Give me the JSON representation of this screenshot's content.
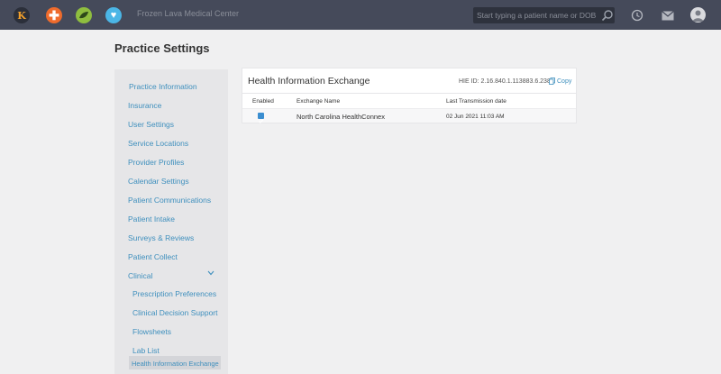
{
  "topbar": {
    "apps": [
      {
        "icon": "kareo-k-icon",
        "glyph": "K"
      },
      {
        "icon": "medical-plus-icon",
        "glyph": "✚"
      },
      {
        "icon": "leaf-icon",
        "glyph": ""
      },
      {
        "icon": "heart-icon",
        "glyph": "♥"
      }
    ],
    "center_name": "Frozen Lava Medical Center",
    "search": {
      "placeholder": "Start typing a patient name or DOB",
      "value": ""
    },
    "icons": [
      "search-icon",
      "history-icon",
      "mail-icon",
      "avatar"
    ]
  },
  "page": {
    "title": "Practice Settings"
  },
  "sidebar": {
    "items": [
      {
        "label": "Practice Information"
      },
      {
        "label": "Insurance"
      },
      {
        "label": "User Settings"
      },
      {
        "label": "Service Locations"
      },
      {
        "label": "Provider Profiles"
      },
      {
        "label": "Calendar Settings"
      },
      {
        "label": "Patient Communications"
      },
      {
        "label": "Patient Intake"
      },
      {
        "label": "Surveys & Reviews"
      },
      {
        "label": "Patient Collect"
      },
      {
        "label": "Clinical",
        "expanded": true
      }
    ],
    "sub_items": [
      {
        "label": "Prescription Preferences"
      },
      {
        "label": "Clinical Decision Support"
      },
      {
        "label": "Flowsheets"
      },
      {
        "label": "Lab List"
      },
      {
        "label": "Health Information Exchange",
        "active": true
      }
    ]
  },
  "panel": {
    "title": "Health Information Exchange",
    "hie_id": "HIE ID: 2.16.840.1.113883.6.238",
    "copy_label": "Copy",
    "columns": [
      "Enabled",
      "Exchange Name",
      "Last Transmission date"
    ],
    "rows": [
      {
        "enabled": true,
        "name": "North  Carolina  HealthConnex",
        "date": "02 Jun 2021 11:03 AM"
      }
    ]
  },
  "colors": {
    "topbar": "#454a5a",
    "link": "#3e8fbd",
    "checkbox": "#3b8ed0",
    "background": "#f0f0f1"
  }
}
